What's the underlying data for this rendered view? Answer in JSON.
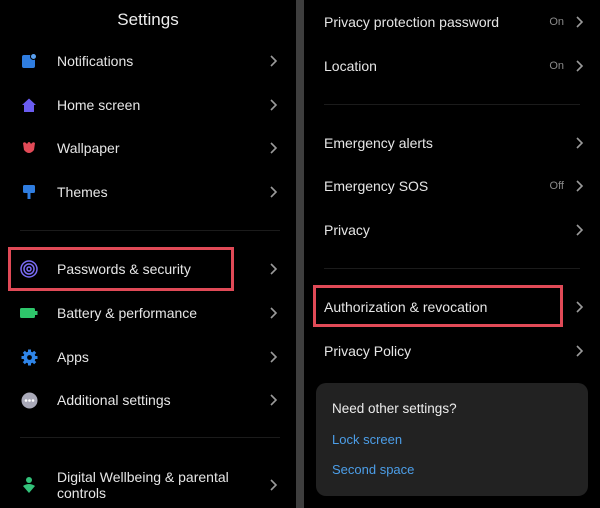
{
  "left": {
    "title": "Settings",
    "items": [
      {
        "label": "Notifications",
        "icon": "notifications-icon"
      },
      {
        "label": "Home screen",
        "icon": "home-icon"
      },
      {
        "label": "Wallpaper",
        "icon": "wallpaper-icon"
      },
      {
        "label": "Themes",
        "icon": "themes-icon"
      },
      {
        "label": "Passwords & security",
        "icon": "fingerprint-icon"
      },
      {
        "label": "Battery & performance",
        "icon": "battery-icon"
      },
      {
        "label": "Apps",
        "icon": "gear-icon"
      },
      {
        "label": "Additional settings",
        "icon": "more-icon"
      },
      {
        "label_line1": "Digital Wellbeing & parental",
        "label_line2": "controls",
        "icon": "wellbeing-icon"
      }
    ]
  },
  "right": {
    "items": [
      {
        "label": "Privacy protection password",
        "value": "On"
      },
      {
        "label": "Location",
        "value": "On"
      },
      {
        "label": "Emergency alerts"
      },
      {
        "label": "Emergency SOS",
        "value": "Off"
      },
      {
        "label": "Privacy"
      },
      {
        "label": "Authorization & revocation"
      },
      {
        "label": "Privacy Policy"
      }
    ],
    "card": {
      "question": "Need other settings?",
      "links": [
        "Lock screen",
        "Second space"
      ]
    }
  },
  "colors": {
    "background": "#000000",
    "highlight_box": "#e04a57",
    "link": "#4c9ee8",
    "card_bg": "#222222"
  }
}
